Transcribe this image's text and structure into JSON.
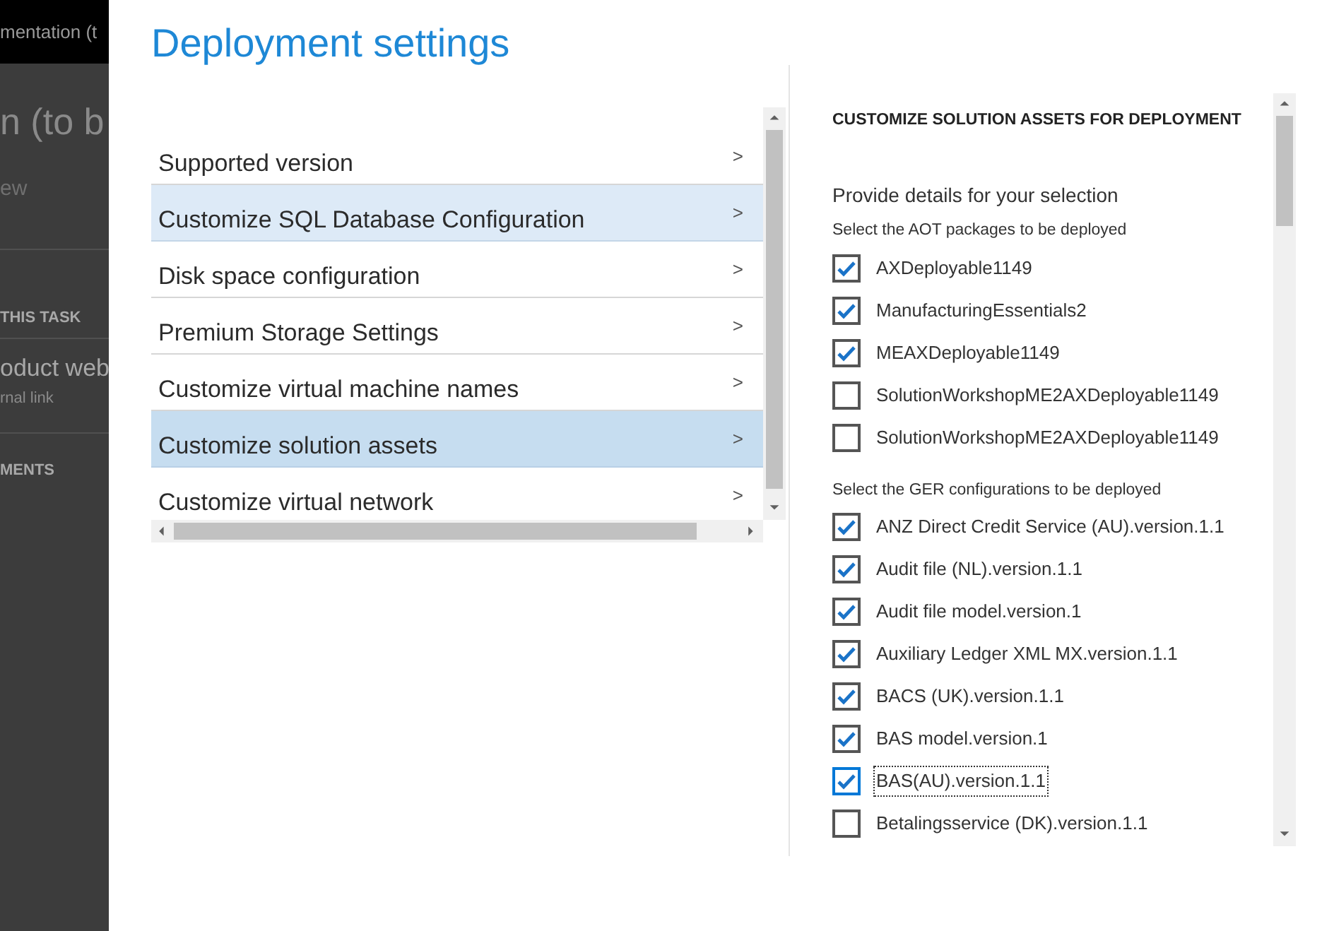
{
  "background_page": {
    "top_bar_text": "mentation (t",
    "heading": "n (to b",
    "link": "ew",
    "section_1": "THIS TASK",
    "item_title": "oduct web",
    "item_subtitle": "rnal link",
    "section_2": "MENTS"
  },
  "dialog": {
    "title": "Deployment settings",
    "menu_items": [
      {
        "label": "Supported version",
        "selected": false,
        "hovered": false,
        "chevron": ">"
      },
      {
        "label": "Customize SQL Database Configuration",
        "selected": false,
        "hovered": true,
        "chevron": ">"
      },
      {
        "label": "Disk space configuration",
        "selected": false,
        "hovered": false,
        "chevron": ">"
      },
      {
        "label": "Premium Storage Settings",
        "selected": false,
        "hovered": false,
        "chevron": ">"
      },
      {
        "label": "Customize virtual machine names",
        "selected": false,
        "hovered": false,
        "chevron": ">"
      },
      {
        "label": "Customize solution assets",
        "selected": true,
        "hovered": false,
        "chevron": ">"
      },
      {
        "label": "Customize virtual network",
        "selected": false,
        "hovered": false,
        "chevron": ">"
      }
    ],
    "panel": {
      "heading": "CUSTOMIZE SOLUTION ASSETS FOR DEPLOYMENT",
      "intro": "Provide details for your selection",
      "groups": [
        {
          "label": "Select the AOT packages to be deployed",
          "items": [
            {
              "label": "AXDeployable1149",
              "checked": true,
              "focused": false
            },
            {
              "label": "ManufacturingEssentials2",
              "checked": true,
              "focused": false
            },
            {
              "label": "MEAXDeployable1149",
              "checked": true,
              "focused": false
            },
            {
              "label": "SolutionWorkshopME2AXDeployable1149",
              "checked": false,
              "focused": false
            },
            {
              "label": "SolutionWorkshopME2AXDeployable1149",
              "checked": false,
              "focused": false
            }
          ]
        },
        {
          "label": "Select the GER configurations to be deployed",
          "items": [
            {
              "label": "ANZ Direct Credit Service (AU).version.1.1",
              "checked": true,
              "focused": false
            },
            {
              "label": "Audit file (NL).version.1.1",
              "checked": true,
              "focused": false
            },
            {
              "label": "Audit file model.version.1",
              "checked": true,
              "focused": false
            },
            {
              "label": "Auxiliary Ledger XML MX.version.1.1",
              "checked": true,
              "focused": false
            },
            {
              "label": "BACS (UK).version.1.1",
              "checked": true,
              "focused": false
            },
            {
              "label": "BAS model.version.1",
              "checked": true,
              "focused": false
            },
            {
              "label": "BAS(AU).version.1.1",
              "checked": true,
              "focused": true
            },
            {
              "label": "Betalingsservice (DK).version.1.1",
              "checked": false,
              "focused": false
            }
          ]
        }
      ]
    }
  }
}
